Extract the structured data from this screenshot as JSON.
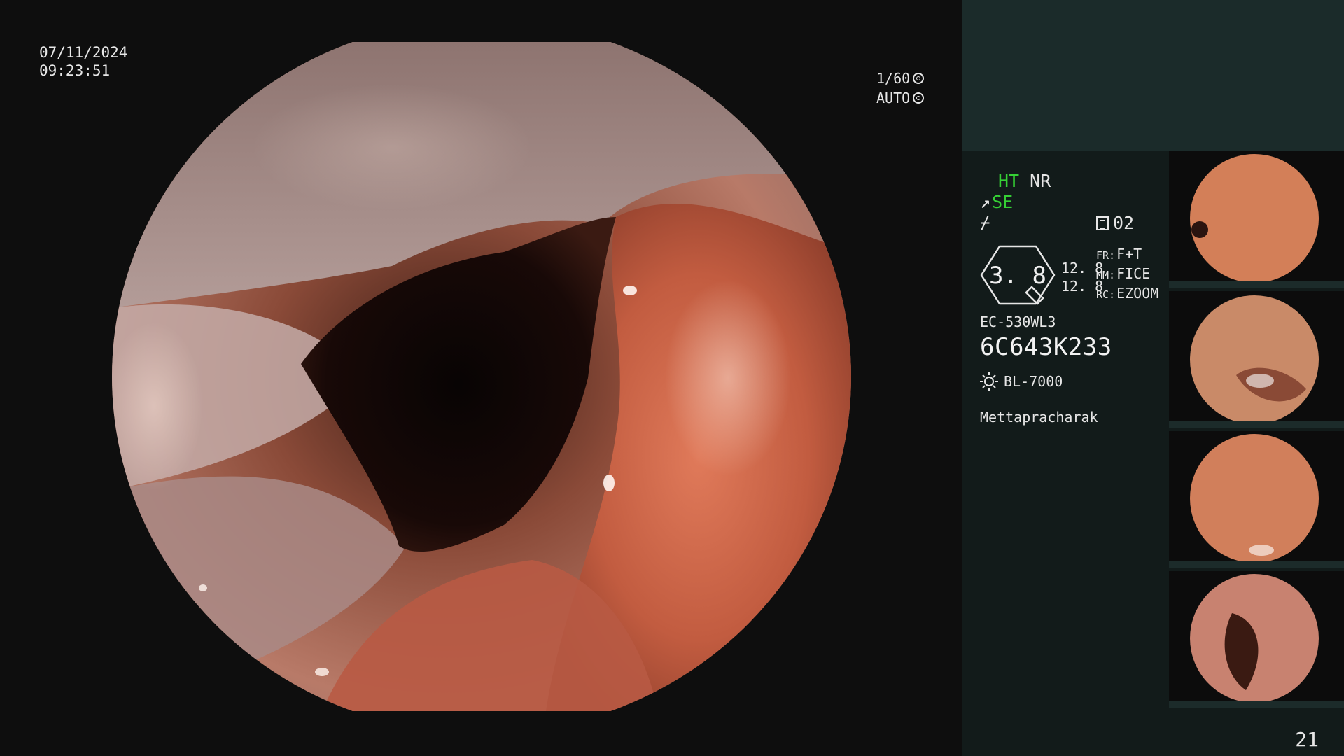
{
  "main": {
    "date": "07/11/2024",
    "time": "09:23:51",
    "shutter_speed": "1/60",
    "iris_mode": "AUTO",
    "icons": [
      "shutter-icon",
      "iris-icon"
    ]
  },
  "info_panel": {
    "ht_label": "HT",
    "nr_label": "NR",
    "se_label": "SE",
    "memo_count": "02",
    "zoom_gauge": "3. 8",
    "zoom_value_1": "12. 8",
    "zoom_value_2": "12. 8",
    "fr_key": "FR:",
    "fr_value": "F+T",
    "mm_key": "MM:",
    "mm_value": "FICE",
    "rc_key": "RC:",
    "rc_value": "EZOOM",
    "scope_model": "EC-530WL3",
    "scope_serial": "6C643K233",
    "light_source": "BL-7000",
    "operator": "Mettapracharak",
    "accent_green": "#35d035"
  },
  "thumbnails": {
    "count": 4
  },
  "footer": {
    "page_number": "21"
  }
}
